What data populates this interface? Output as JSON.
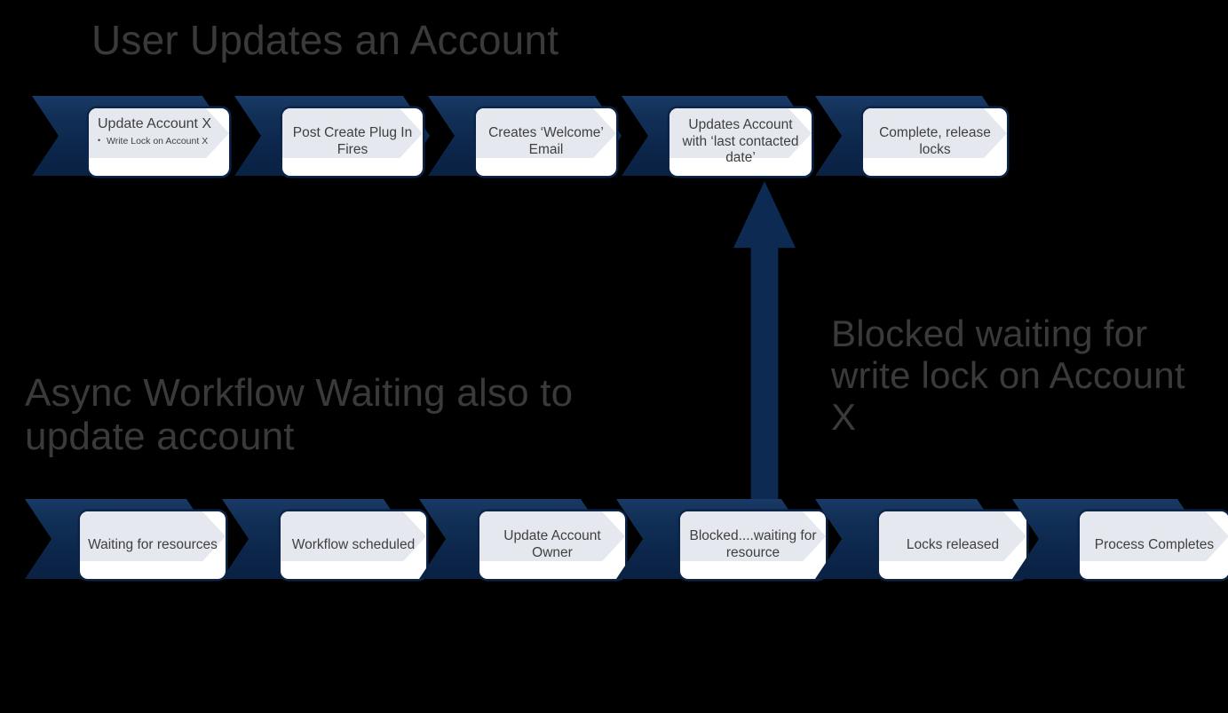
{
  "diagram": {
    "background_color": "#000000",
    "accent_navy": "#0c2a52",
    "card_wash_color": "#e5e9ef",
    "heading_color": "#3a3a3a"
  },
  "headings": {
    "top_title": "User Updates an Account",
    "async_title": "Async Workflow Waiting also to update account",
    "blocked_label": "Blocked waiting for write lock on Account X"
  },
  "arrow": {
    "name": "blocked-waiting-arrow",
    "direction": "up",
    "color": "#0c2a52"
  },
  "top_row": {
    "name": "user-updates-account-process",
    "steps": [
      {
        "title": "Update Account X",
        "bullets": [
          "Write  Lock on Account  X"
        ]
      },
      {
        "title": "Post Create Plug In Fires",
        "bullets": []
      },
      {
        "title": "Creates ‘Welcome’ Email",
        "bullets": []
      },
      {
        "title": "Updates Account with ‘last contacted date’",
        "bullets": []
      },
      {
        "title": "Complete, release locks",
        "bullets": []
      }
    ]
  },
  "bottom_row": {
    "name": "async-workflow-process",
    "steps": [
      {
        "title": "Waiting for resources",
        "bullets": []
      },
      {
        "title": "Workflow scheduled",
        "bullets": []
      },
      {
        "title": "Update Account Owner",
        "bullets": []
      },
      {
        "title": "Blocked....waiting for resource",
        "bullets": []
      },
      {
        "title": "Locks released",
        "bullets": []
      },
      {
        "title": "Process Completes",
        "bullets": []
      }
    ]
  }
}
